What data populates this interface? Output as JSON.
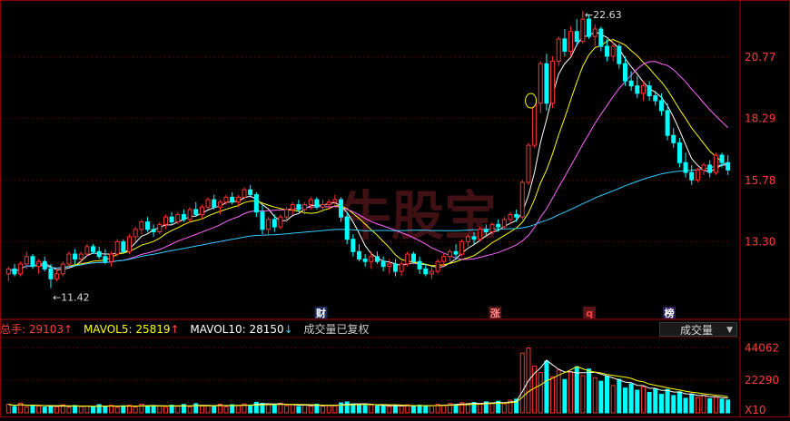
{
  "chart_data": [
    {
      "type": "candlestick",
      "title": "",
      "ylim": [
        10.6,
        23.0
      ],
      "yticks": [
        "20.77",
        "18.29",
        "15.78",
        "13.30"
      ],
      "ytick_values": [
        20.77,
        18.29,
        15.78,
        13.3
      ],
      "high_label": "22.63",
      "low_label": "11.42",
      "event_markers": [
        "财",
        "涨",
        "q",
        "榜"
      ],
      "watermark": "牛股宝",
      "colors": {
        "up": "#ff3232",
        "down": "#00ffff",
        "ma5": "#ffffff",
        "ma10": "#ffff00",
        "ma20": "#ff66ff",
        "ma60": "#33ccff"
      },
      "candles": [
        [
          12.0,
          12.3,
          11.7,
          12.2
        ],
        [
          12.2,
          12.4,
          11.9,
          12.0
        ],
        [
          12.0,
          12.5,
          11.9,
          12.4
        ],
        [
          12.4,
          12.9,
          12.2,
          12.7
        ],
        [
          12.7,
          12.8,
          12.2,
          12.3
        ],
        [
          12.3,
          12.6,
          12.0,
          12.5
        ],
        [
          12.5,
          12.7,
          12.1,
          12.2
        ],
        [
          12.2,
          12.4,
          11.42,
          11.8
        ],
        [
          11.8,
          12.2,
          11.7,
          12.0
        ],
        [
          12.0,
          12.5,
          11.9,
          12.4
        ],
        [
          12.4,
          12.9,
          12.3,
          12.8
        ],
        [
          12.8,
          13.0,
          12.4,
          12.6
        ],
        [
          12.6,
          12.9,
          12.4,
          12.8
        ],
        [
          12.8,
          13.2,
          12.7,
          13.1
        ],
        [
          13.1,
          13.2,
          12.8,
          12.9
        ],
        [
          12.9,
          13.1,
          12.6,
          12.7
        ],
        [
          12.7,
          13.0,
          12.4,
          12.5
        ],
        [
          12.5,
          12.9,
          12.3,
          12.8
        ],
        [
          12.8,
          13.4,
          12.7,
          13.3
        ],
        [
          13.3,
          13.4,
          12.8,
          12.9
        ],
        [
          12.9,
          13.6,
          12.8,
          13.5
        ],
        [
          13.5,
          13.9,
          13.3,
          13.8
        ],
        [
          13.8,
          14.2,
          13.6,
          14.1
        ],
        [
          14.1,
          14.3,
          13.7,
          13.8
        ],
        [
          13.8,
          14.0,
          13.5,
          13.7
        ],
        [
          13.7,
          14.1,
          13.6,
          14.0
        ],
        [
          14.0,
          14.4,
          13.8,
          14.3
        ],
        [
          14.3,
          14.5,
          14.0,
          14.1
        ],
        [
          14.1,
          14.5,
          14.0,
          14.4
        ],
        [
          14.4,
          14.6,
          14.1,
          14.2
        ],
        [
          14.2,
          14.7,
          14.1,
          14.6
        ],
        [
          14.6,
          14.9,
          14.3,
          14.4
        ],
        [
          14.4,
          14.8,
          14.2,
          14.7
        ],
        [
          14.7,
          15.1,
          14.6,
          15.0
        ],
        [
          15.0,
          15.2,
          14.6,
          14.7
        ],
        [
          14.7,
          15.0,
          14.4,
          14.9
        ],
        [
          14.9,
          15.2,
          14.8,
          15.1
        ],
        [
          15.1,
          15.3,
          14.8,
          14.9
        ],
        [
          14.9,
          15.2,
          14.7,
          15.1
        ],
        [
          15.1,
          15.5,
          15.0,
          15.4
        ],
        [
          15.4,
          15.6,
          15.1,
          15.2
        ],
        [
          15.2,
          15.3,
          14.3,
          14.5
        ],
        [
          14.5,
          14.8,
          13.6,
          13.8
        ],
        [
          13.8,
          14.3,
          13.6,
          14.2
        ],
        [
          14.2,
          14.4,
          13.7,
          13.9
        ],
        [
          13.9,
          14.4,
          13.8,
          14.3
        ],
        [
          14.3,
          14.7,
          14.1,
          14.6
        ],
        [
          14.6,
          14.9,
          14.4,
          14.8
        ],
        [
          14.8,
          15.0,
          14.5,
          14.6
        ],
        [
          14.6,
          14.9,
          14.4,
          14.8
        ],
        [
          14.8,
          15.1,
          14.6,
          15.0
        ],
        [
          15.0,
          15.1,
          14.6,
          14.7
        ],
        [
          14.7,
          15.0,
          14.5,
          14.8
        ],
        [
          14.8,
          15.0,
          14.6,
          14.9
        ],
        [
          14.9,
          15.2,
          14.8,
          15.0
        ],
        [
          15.0,
          15.1,
          14.1,
          14.3
        ],
        [
          14.3,
          14.5,
          13.2,
          13.4
        ],
        [
          13.4,
          13.6,
          12.7,
          12.9
        ],
        [
          12.9,
          13.2,
          12.5,
          12.6
        ],
        [
          12.6,
          12.8,
          12.3,
          12.5
        ],
        [
          12.5,
          12.9,
          12.2,
          12.7
        ],
        [
          12.7,
          12.9,
          12.4,
          12.5
        ],
        [
          12.5,
          12.7,
          12.1,
          12.3
        ],
        [
          12.3,
          12.6,
          12.0,
          12.4
        ],
        [
          12.4,
          12.6,
          11.9,
          12.1
        ],
        [
          12.1,
          12.5,
          11.9,
          12.4
        ],
        [
          12.4,
          12.9,
          12.3,
          12.8
        ],
        [
          12.8,
          12.9,
          12.4,
          12.5
        ],
        [
          12.5,
          12.7,
          12.0,
          12.2
        ],
        [
          12.2,
          12.4,
          11.9,
          12.0
        ],
        [
          12.0,
          12.3,
          11.8,
          12.1
        ],
        [
          12.1,
          12.6,
          12.0,
          12.5
        ],
        [
          12.5,
          12.8,
          12.3,
          12.7
        ],
        [
          12.7,
          13.0,
          12.5,
          12.9
        ],
        [
          12.9,
          13.2,
          12.6,
          12.8
        ],
        [
          12.8,
          13.4,
          12.7,
          13.3
        ],
        [
          13.3,
          13.6,
          13.1,
          13.5
        ],
        [
          13.5,
          13.7,
          13.2,
          13.4
        ],
        [
          13.4,
          13.9,
          13.3,
          13.8
        ],
        [
          13.8,
          14.0,
          13.5,
          13.7
        ],
        [
          13.7,
          14.1,
          13.6,
          14.0
        ],
        [
          14.0,
          14.2,
          13.7,
          13.9
        ],
        [
          13.9,
          14.3,
          13.8,
          14.2
        ],
        [
          14.2,
          14.5,
          14.0,
          14.4
        ],
        [
          14.4,
          14.6,
          14.1,
          14.3
        ],
        [
          14.3,
          15.8,
          14.2,
          15.7
        ],
        [
          15.7,
          17.3,
          15.6,
          17.2
        ],
        [
          17.2,
          19.0,
          17.1,
          18.9
        ],
        [
          18.9,
          20.6,
          18.5,
          20.5
        ],
        [
          20.5,
          20.9,
          18.6,
          18.9
        ],
        [
          18.9,
          20.8,
          18.7,
          20.6
        ],
        [
          20.6,
          21.6,
          20.4,
          21.5
        ],
        [
          21.5,
          21.9,
          20.8,
          21.0
        ],
        [
          21.0,
          22.0,
          20.8,
          21.8
        ],
        [
          21.8,
          22.3,
          21.2,
          21.4
        ],
        [
          21.4,
          22.63,
          21.3,
          22.3
        ],
        [
          22.3,
          22.5,
          21.5,
          21.6
        ],
        [
          21.6,
          22.1,
          21.2,
          21.9
        ],
        [
          21.9,
          22.0,
          21.0,
          21.2
        ],
        [
          21.2,
          21.5,
          20.6,
          20.8
        ],
        [
          20.8,
          21.4,
          20.6,
          21.2
        ],
        [
          21.2,
          21.3,
          20.3,
          20.5
        ],
        [
          20.5,
          20.8,
          19.6,
          19.8
        ],
        [
          19.8,
          20.2,
          19.4,
          19.6
        ],
        [
          19.6,
          20.0,
          19.1,
          19.3
        ],
        [
          19.3,
          19.8,
          19.0,
          19.6
        ],
        [
          19.6,
          19.8,
          19.0,
          19.2
        ],
        [
          19.2,
          19.4,
          18.8,
          19.0
        ],
        [
          19.0,
          19.3,
          18.4,
          18.6
        ],
        [
          18.6,
          18.9,
          17.4,
          17.6
        ],
        [
          17.6,
          17.9,
          17.1,
          17.3
        ],
        [
          17.3,
          17.5,
          16.3,
          16.5
        ],
        [
          16.5,
          16.9,
          15.9,
          16.1
        ],
        [
          16.1,
          16.4,
          15.6,
          15.8
        ],
        [
          15.8,
          16.3,
          15.7,
          16.2
        ],
        [
          16.2,
          16.5,
          16.0,
          16.4
        ],
        [
          16.4,
          16.6,
          15.9,
          16.1
        ],
        [
          16.1,
          16.9,
          16.0,
          16.8
        ],
        [
          16.8,
          16.9,
          16.3,
          16.5
        ],
        [
          16.5,
          16.8,
          16.0,
          16.2
        ]
      ],
      "volume": {
        "ylim": [
          0,
          50000
        ],
        "yticks": [
          "44062",
          "22290",
          "X10"
        ],
        "ytick_values": [
          44062,
          22290
        ],
        "labels": {
          "total": "总手: 29103",
          "mavol5": "MAVOL5: 25819",
          "mavol10": "MAVOL10: 28150",
          "note": "成交量已复权",
          "dropdown": "成交量"
        },
        "values": [
          5800,
          4300,
          6600,
          4100,
          5200,
          4700,
          3900,
          4900,
          4200,
          5400,
          3800,
          5000,
          4300,
          4600,
          3900,
          5600,
          4200,
          5100,
          3700,
          4800,
          5300,
          4000,
          5900,
          4400,
          5000,
          4600,
          3800,
          5200,
          4500,
          5700,
          4100,
          6200,
          4700,
          5000,
          4400,
          5800,
          4200,
          5500,
          4900,
          6100,
          5300,
          7200,
          6500,
          5800,
          5100,
          6400,
          4900,
          5600,
          4300,
          5300,
          4700,
          5900,
          4500,
          5200,
          4800,
          6800,
          7400,
          6100,
          5600,
          4900,
          5400,
          4600,
          5100,
          4300,
          5000,
          4700,
          5500,
          4400,
          5200,
          4800,
          4900,
          5800,
          5300,
          6300,
          5700,
          6900,
          6400,
          7000,
          5900,
          7500,
          6800,
          7900,
          6200,
          8600,
          9300,
          40600,
          44100,
          31800,
          27400,
          35200,
          24600,
          29100,
          22700,
          27900,
          31400,
          25300,
          29800,
          23900,
          21500,
          24900,
          18600,
          22800,
          16900,
          19700,
          15400,
          17800,
          13900,
          16400,
          12600,
          15900,
          11800,
          14300,
          9900,
          12700,
          10400,
          11900,
          9600,
          10800,
          9300,
          8700
        ]
      }
    }
  ]
}
